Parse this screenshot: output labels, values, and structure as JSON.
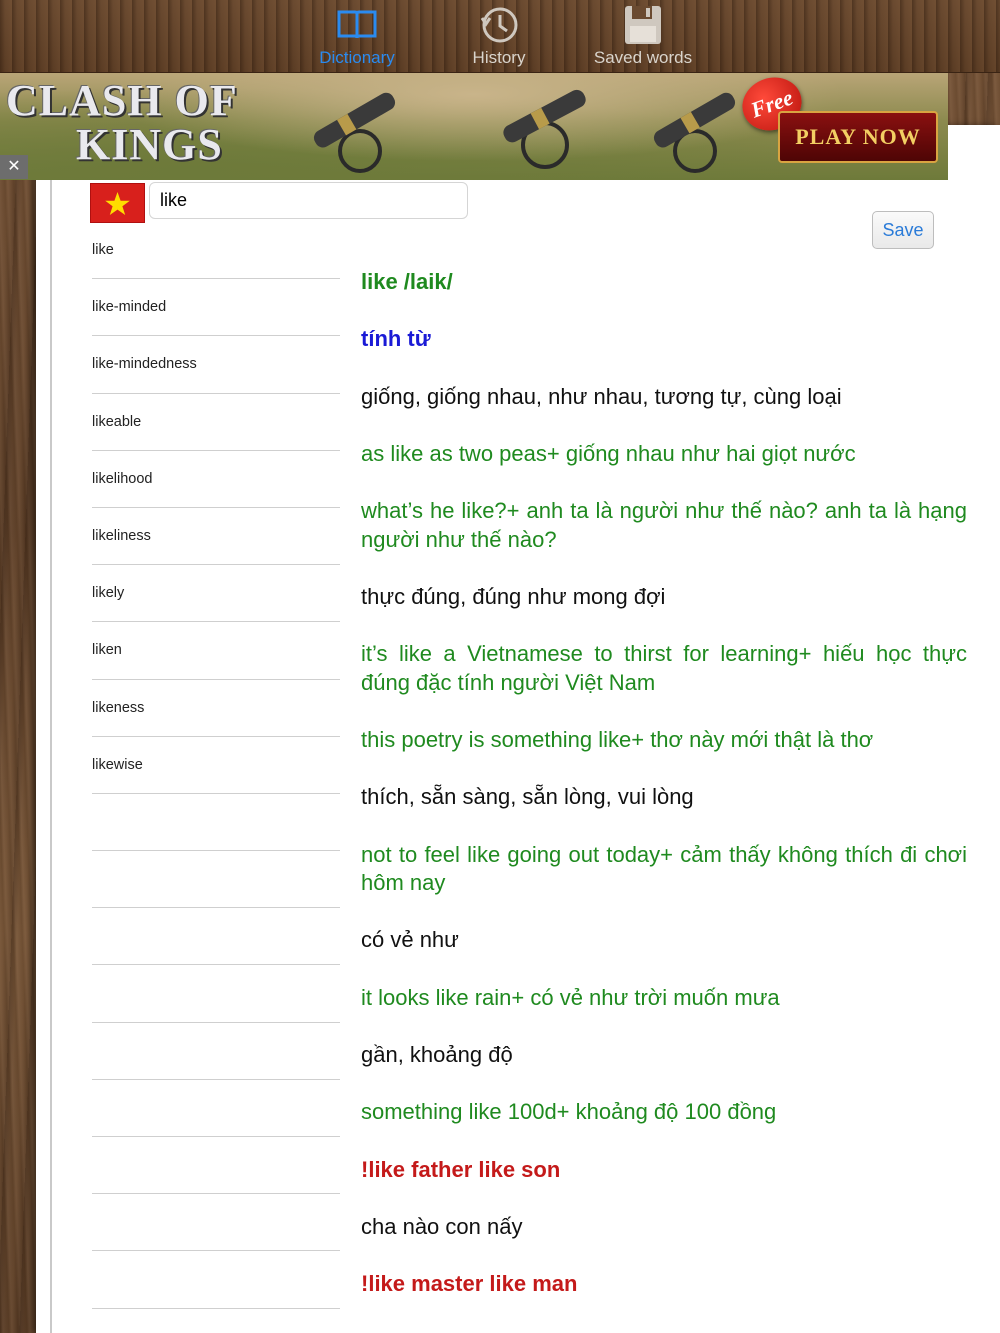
{
  "tabs": [
    {
      "label": "Dictionary",
      "icon": "book-icon",
      "active": true
    },
    {
      "label": "History",
      "icon": "clock-icon",
      "active": false
    },
    {
      "label": "Saved words",
      "icon": "floppy-disk-icon",
      "active": false
    }
  ],
  "ad": {
    "logo_line1": "CLASH OF",
    "logo_line2": "KINGS",
    "badge": "Free",
    "cta": "PLAY NOW",
    "close": "✕"
  },
  "search": {
    "value": "like",
    "flag": "vietnam-flag-icon"
  },
  "save_label": "Save",
  "word_list": [
    "like",
    "like-minded",
    "like-mindedness",
    "likeable",
    "likelihood",
    "likeliness",
    "likely",
    "liken",
    "likeness",
    "likewise",
    "",
    "",
    "",
    "",
    "",
    "",
    "",
    "",
    ""
  ],
  "definition": [
    {
      "type": "headword",
      "text": "like /laik/"
    },
    {
      "type": "pos",
      "text": "tính từ"
    },
    {
      "type": "meaning",
      "text": "giống, giống nhau, như nhau, tương tự, cùng loại"
    },
    {
      "type": "example",
      "text": "as like as two peas+ giống nhau như hai giọt nước"
    },
    {
      "type": "example",
      "text": "what’s he like?+ anh ta là người như thế nào? anh ta là hạng người như thế nào?"
    },
    {
      "type": "meaning",
      "text": "thực đúng, đúng như mong đợi"
    },
    {
      "type": "example",
      "text": "it’s like a Vietnamese to thirst for learning+ hiếu học thực đúng đặc tính người Việt Nam"
    },
    {
      "type": "example",
      "text": "this poetry is something like+ thơ này mới thật là thơ"
    },
    {
      "type": "meaning",
      "text": "thích, sẵn sàng, sẵn lòng, vui lòng"
    },
    {
      "type": "example",
      "text": "not to feel like going out today+ cảm thấy không thích đi chơi hôm nay"
    },
    {
      "type": "meaning",
      "text": "có vẻ như"
    },
    {
      "type": "example",
      "text": "it looks like rain+ có vẻ như trời muốn mưa"
    },
    {
      "type": "meaning",
      "text": "gần, khoảng độ"
    },
    {
      "type": "example",
      "text": "something like 100d+ khoảng độ 100 đồng"
    },
    {
      "type": "idiom",
      "text": "!like father like son"
    },
    {
      "type": "meaning",
      "text": "cha nào con nấy"
    },
    {
      "type": "idiom",
      "text": "!like master like man"
    }
  ],
  "colors": {
    "active_tab": "#2a8bf0",
    "headword": "#1f8a1f",
    "pos": "#1a1ad6",
    "example": "#1f8a1f",
    "idiom": "#c41a1a"
  }
}
